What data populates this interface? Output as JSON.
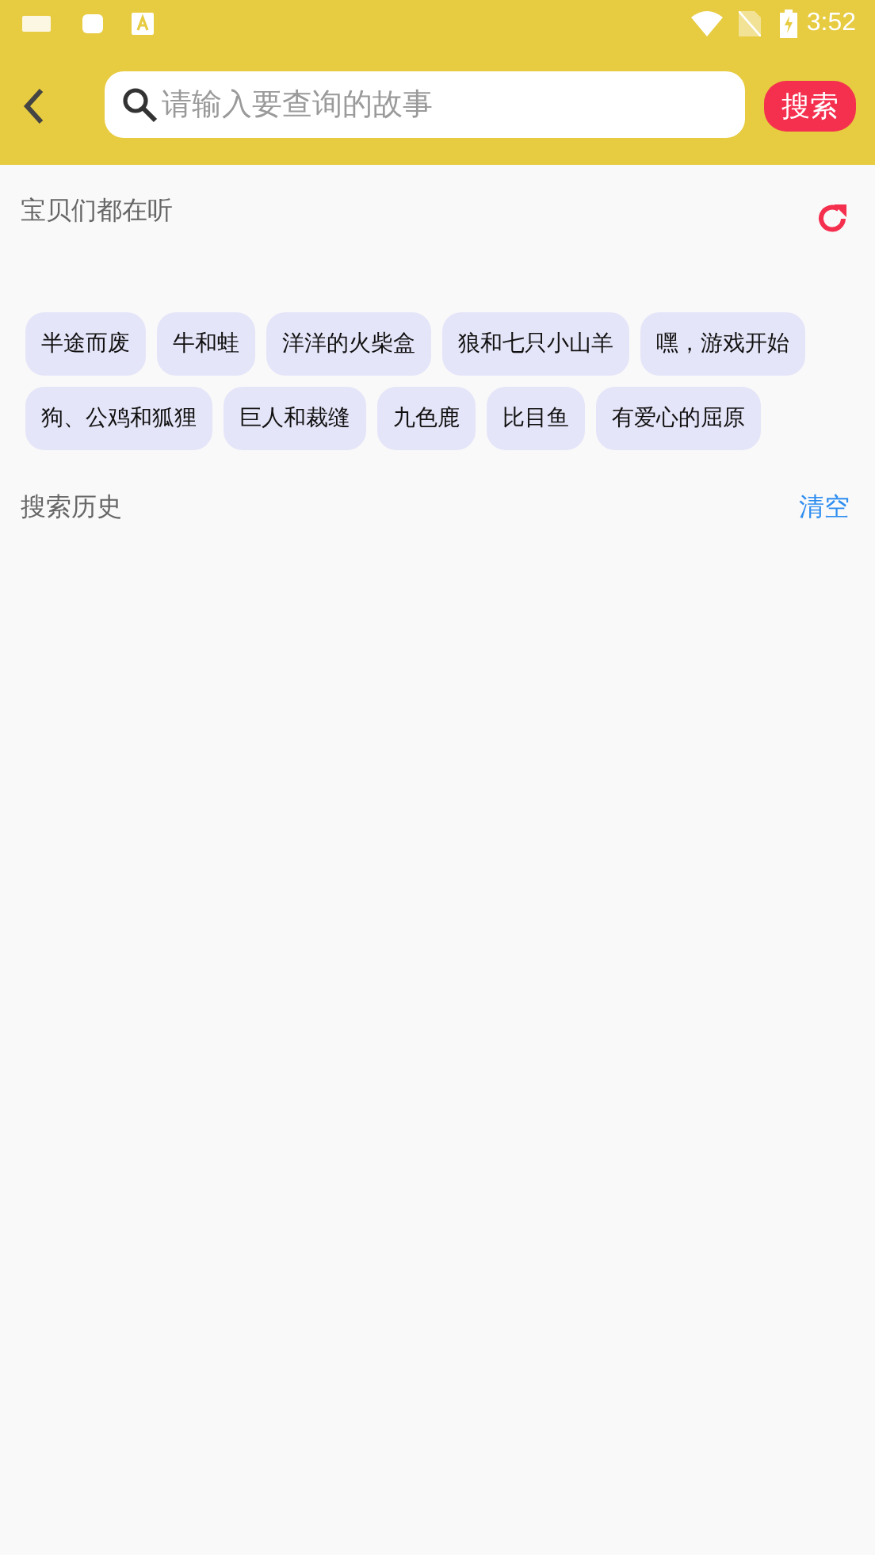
{
  "status_bar": {
    "time": "3:52"
  },
  "search": {
    "placeholder": "请输入要查询的故事",
    "button": "搜索"
  },
  "popular": {
    "title": "宝贝们都在听",
    "tags": [
      "半途而废",
      "牛和蛙",
      "洋洋的火柴盒",
      "狼和七只小山羊",
      "嘿，游戏开始",
      "狗、公鸡和狐狸",
      "巨人和裁缝",
      "九色鹿",
      "比目鱼",
      "有爱心的屈原"
    ]
  },
  "history": {
    "title": "搜索历史",
    "clear": "清空"
  }
}
